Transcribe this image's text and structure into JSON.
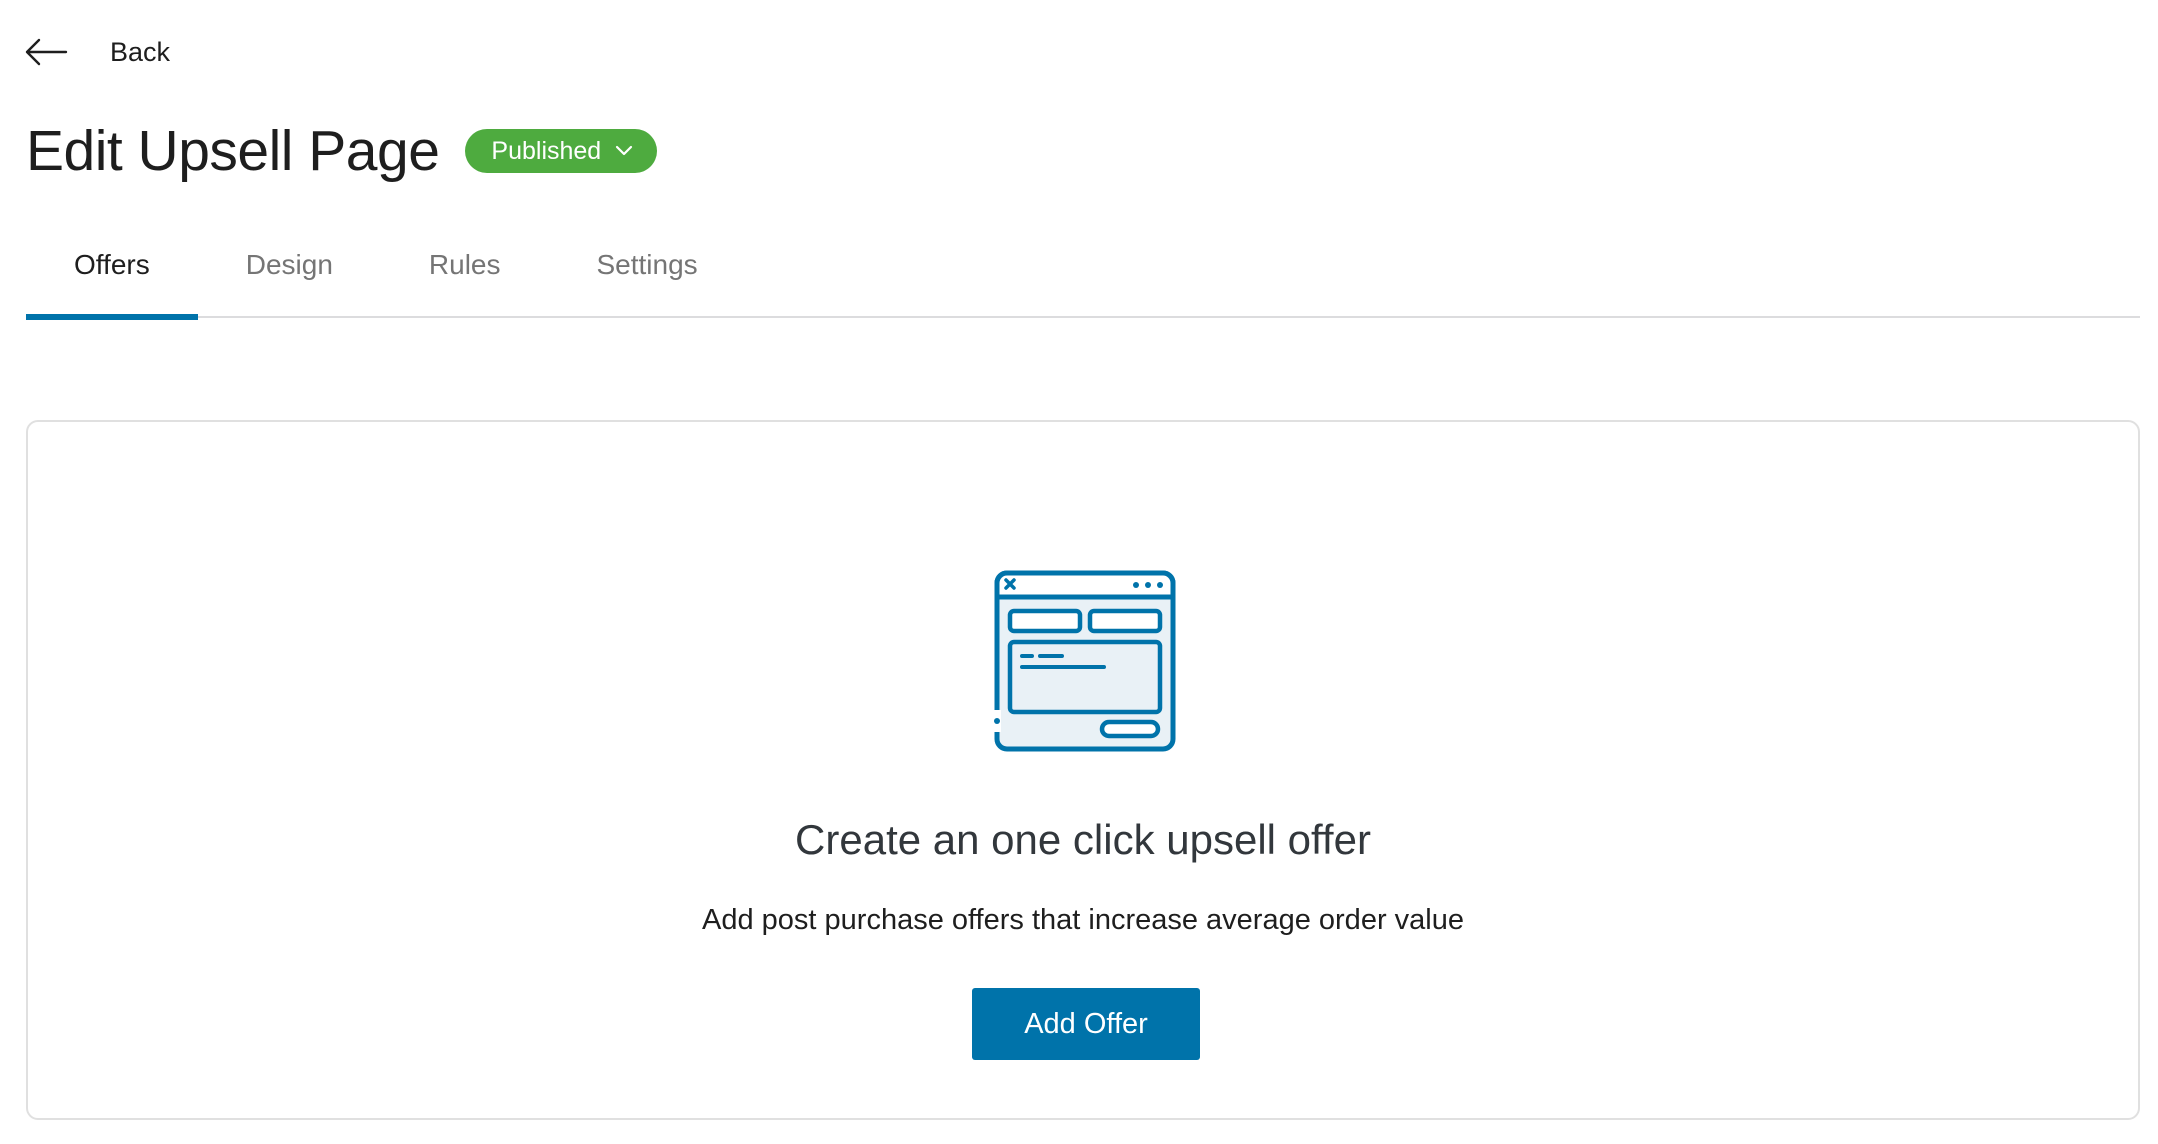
{
  "header": {
    "back_label": "Back",
    "title": "Edit Upsell Page",
    "status": "Published"
  },
  "tabs": [
    {
      "label": "Offers",
      "active": true
    },
    {
      "label": "Design",
      "active": false
    },
    {
      "label": "Rules",
      "active": false
    },
    {
      "label": "Settings",
      "active": false
    }
  ],
  "empty_state": {
    "illustration": "browser-window-icon",
    "title": "Create an one click upsell offer",
    "description": "Add post purchase offers that increase average order value",
    "button_label": "Add Offer"
  },
  "colors": {
    "accent": "#0073aa",
    "status_green": "#4eab3f"
  }
}
